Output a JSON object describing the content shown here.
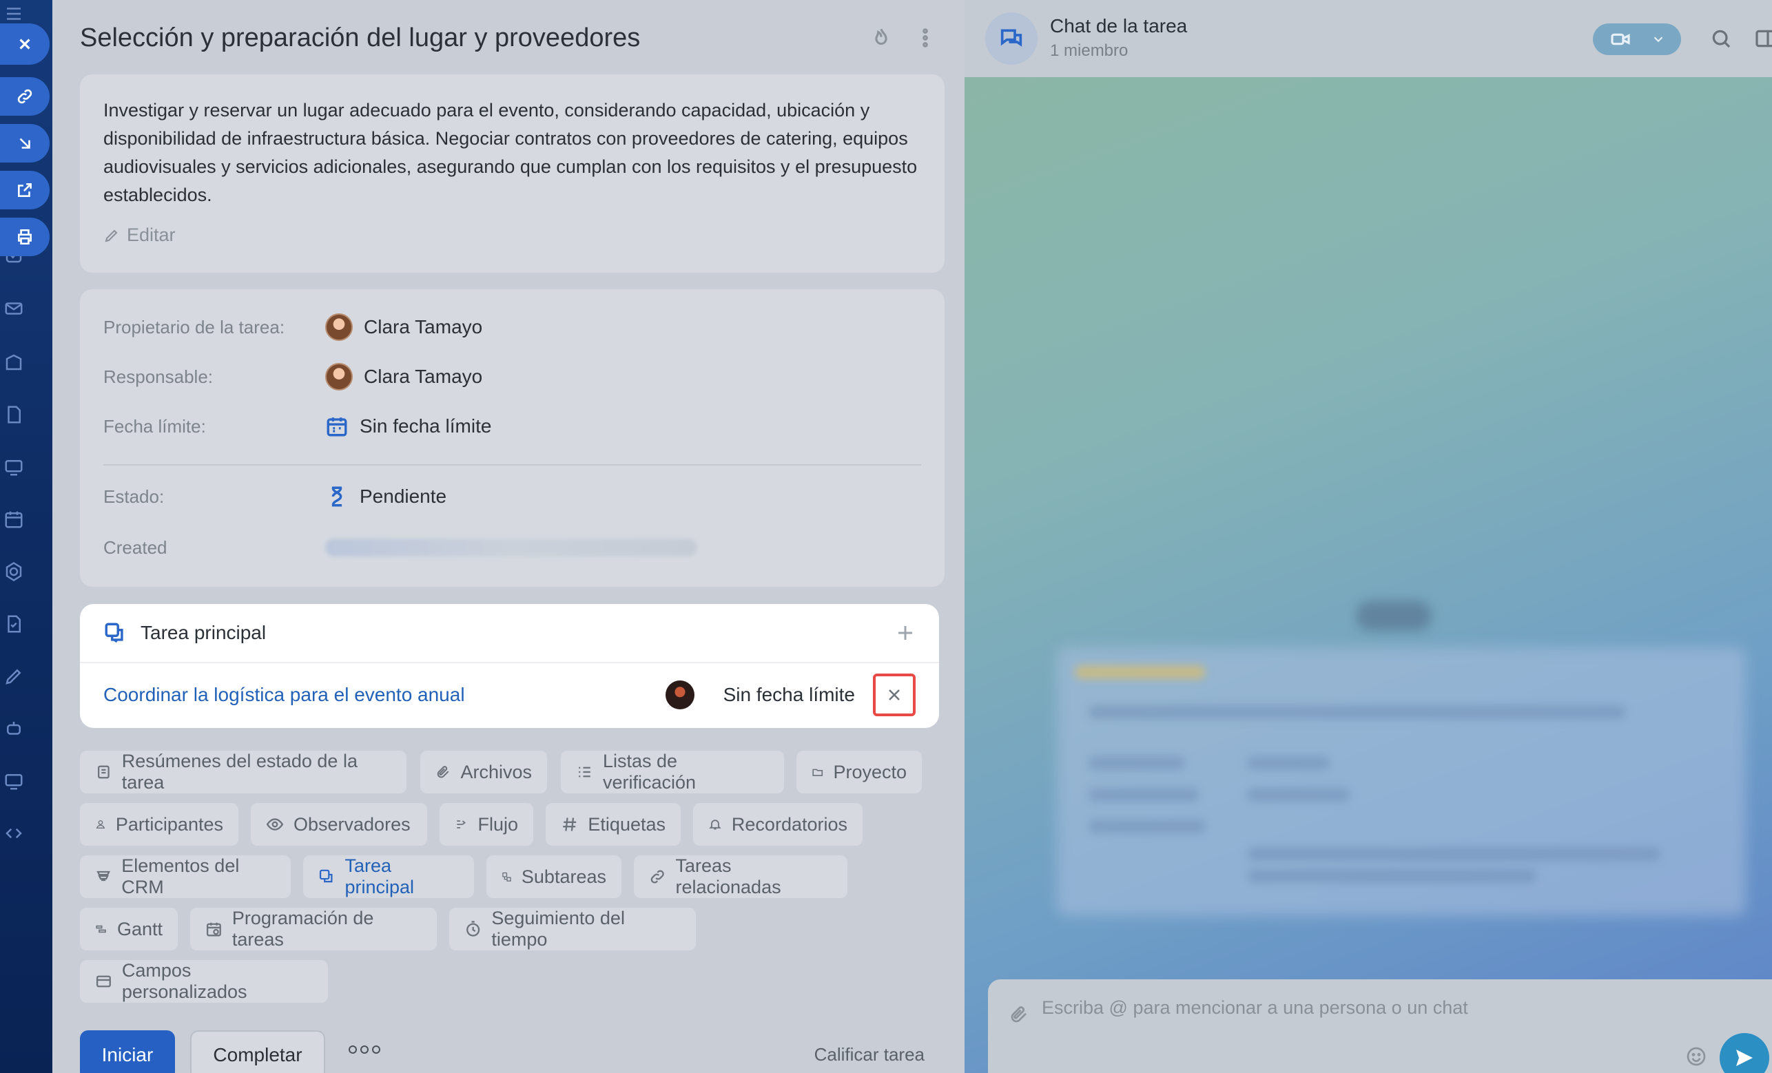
{
  "task": {
    "title": "Selección y preparación del lugar y proveedores",
    "description": "Investigar y reservar un lugar adecuado para el evento, considerando capacidad, ubicación y disponibilidad de infraestructura básica. Negociar contratos con proveedores de catering, equipos audiovisuales y servicios adicionales, asegurando que cumplan con los requisitos y el presupuesto establecidos.",
    "edit_label": "Editar"
  },
  "info": {
    "owner_label": "Propietario de la tarea:",
    "owner_value": "Clara Tamayo",
    "assignee_label": "Responsable:",
    "assignee_value": "Clara Tamayo",
    "deadline_label": "Fecha límite:",
    "deadline_value": "Sin fecha límite",
    "status_label": "Estado:",
    "status_value": "Pendiente",
    "created_label": "Created"
  },
  "parent_task": {
    "header": "Tarea principal",
    "link": "Coordinar la logística para el evento anual",
    "deadline": "Sin fecha límite"
  },
  "chips": [
    {
      "label": "Resúmenes del estado de la tarea",
      "icon": "summary-icon"
    },
    {
      "label": "Archivos",
      "icon": "paperclip-icon"
    },
    {
      "label": "Listas de verificación",
      "icon": "checklist-icon"
    },
    {
      "label": "Proyecto",
      "icon": "folder-icon"
    },
    {
      "label": "Participantes",
      "icon": "user-icon"
    },
    {
      "label": "Observadores",
      "icon": "eye-icon"
    },
    {
      "label": "Flujo",
      "icon": "flow-icon"
    },
    {
      "label": "Etiquetas",
      "icon": "hash-icon"
    },
    {
      "label": "Recordatorios",
      "icon": "bell-icon"
    },
    {
      "label": "Elementos del CRM",
      "icon": "crm-icon"
    },
    {
      "label": "Tarea principal",
      "icon": "parent-task-icon",
      "active": true
    },
    {
      "label": "Subtareas",
      "icon": "subtasks-icon"
    },
    {
      "label": "Tareas relacionadas",
      "icon": "link-icon"
    },
    {
      "label": "Gantt",
      "icon": "gantt-icon"
    },
    {
      "label": "Programación de tareas",
      "icon": "schedule-icon"
    },
    {
      "label": "Seguimiento del tiempo",
      "icon": "timer-icon"
    },
    {
      "label": "Campos personalizados",
      "icon": "fields-icon"
    }
  ],
  "footer": {
    "start": "Iniciar",
    "complete": "Completar",
    "rate": "Calificar tarea"
  },
  "chat": {
    "title": "Chat de la tarea",
    "subtitle": "1 miembro",
    "placeholder": "Escriba @ para mencionar a una persona o un chat"
  },
  "colors": {
    "accent": "#2560c2",
    "highlight": "#e84a45"
  }
}
